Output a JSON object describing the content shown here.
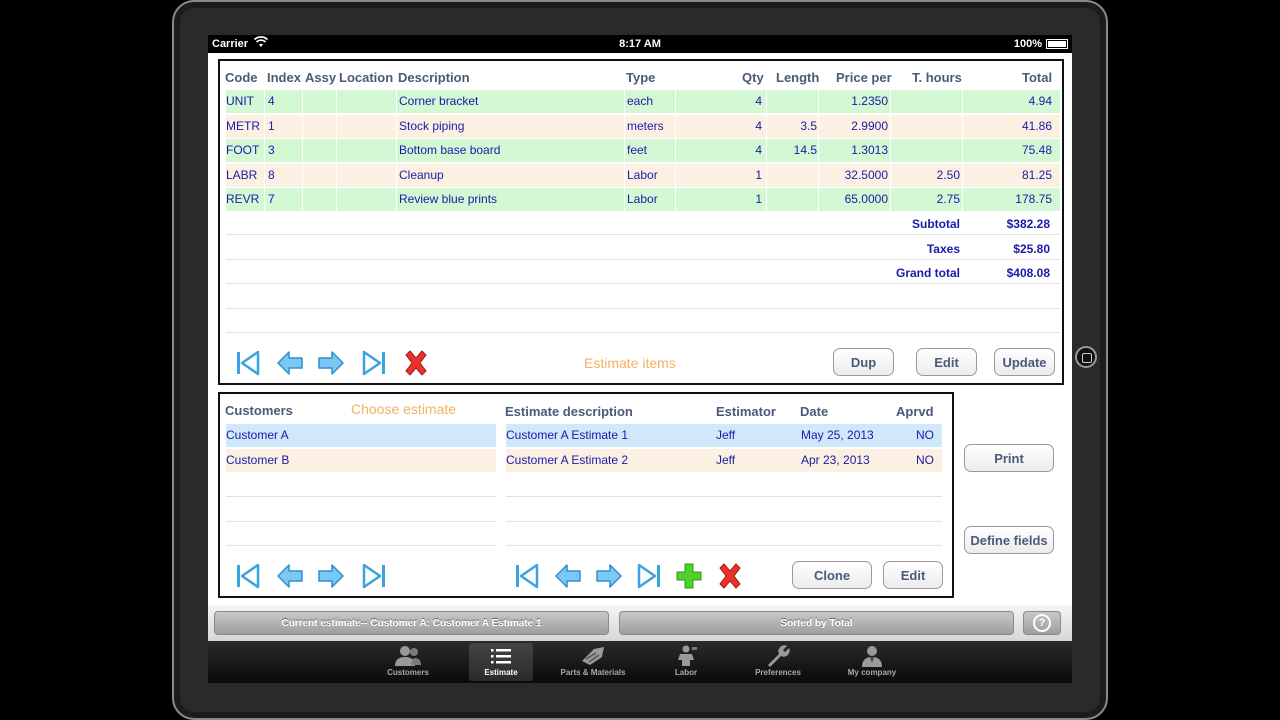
{
  "status_bar": {
    "carrier": "Carrier",
    "time": "8:17 AM",
    "battery": "100%"
  },
  "items_panel": {
    "columns": [
      "Code",
      "Index",
      "Assy",
      "Location",
      "Description",
      "Type",
      "Qty",
      "Length",
      "Price per",
      "T. hours",
      "Total"
    ],
    "rows": [
      {
        "code": "UNIT",
        "index": "4",
        "assy": "",
        "location": "",
        "description": "Corner bracket",
        "type": "each",
        "qty": "4",
        "length": "",
        "price": "1.2350",
        "hours": "",
        "total": "4.94"
      },
      {
        "code": "METR",
        "index": "1",
        "assy": "",
        "location": "",
        "description": "Stock piping",
        "type": "meters",
        "qty": "4",
        "length": "3.5",
        "price": "2.9900",
        "hours": "",
        "total": "41.86"
      },
      {
        "code": "FOOT",
        "index": "3",
        "assy": "",
        "location": "",
        "description": "Bottom base board",
        "type": "feet",
        "qty": "4",
        "length": "14.5",
        "price": "1.3013",
        "hours": "",
        "total": "75.48"
      },
      {
        "code": "LABR",
        "index": "8",
        "assy": "",
        "location": "",
        "description": "Cleanup",
        "type": "Labor",
        "qty": "1",
        "length": "",
        "price": "32.5000",
        "hours": "2.50",
        "total": "81.25"
      },
      {
        "code": "REVR",
        "index": "7",
        "assy": "",
        "location": "",
        "description": "Review blue prints",
        "type": "Labor",
        "qty": "1",
        "length": "",
        "price": "65.0000",
        "hours": "2.75",
        "total": "178.75"
      }
    ],
    "subtotal_label": "Subtotal",
    "subtotal": "$382.28",
    "taxes_label": "Taxes",
    "taxes": "$25.80",
    "grand_label": "Grand total",
    "grand": "$408.08",
    "caption": "Estimate items",
    "buttons": {
      "dup": "Dup",
      "edit": "Edit",
      "update": "Update"
    }
  },
  "estimate_panel": {
    "customers_header": "Customers",
    "choose_caption": "Choose estimate",
    "customers": [
      "Customer A",
      "Customer B"
    ],
    "columns": [
      "Estimate description",
      "Estimator",
      "Date",
      "Aprvd"
    ],
    "estimates": [
      {
        "description": "Customer A Estimate 1",
        "estimator": "Jeff",
        "date": "May 25, 2013",
        "approved": "NO"
      },
      {
        "description": "Customer A Estimate 2",
        "estimator": "Jeff",
        "date": "Apr 23, 2013",
        "approved": "NO"
      }
    ],
    "buttons": {
      "clone": "Clone",
      "edit": "Edit"
    }
  },
  "side_buttons": {
    "print": "Print",
    "define_fields": "Define fields"
  },
  "status_strip": {
    "current_estimate": "Current estimate--  Customer A: Customer A Estimate 1",
    "sorted_by": "Sorted by Total",
    "help": "?"
  },
  "tab_bar": {
    "tabs": [
      {
        "label": "Customers",
        "icon": "customers-icon",
        "active": false
      },
      {
        "label": "Estimate",
        "icon": "list-icon",
        "active": true
      },
      {
        "label": "Parts & Materials",
        "icon": "parts-icon",
        "active": false
      },
      {
        "label": "Labor",
        "icon": "worker-icon",
        "active": false
      },
      {
        "label": "Preferences",
        "icon": "wrench-icon",
        "active": false
      },
      {
        "label": "My company",
        "icon": "company-icon",
        "active": false
      }
    ]
  },
  "colors": {
    "row_green": "#d4f7d4",
    "row_peach": "#fbf0e2",
    "row_selected": "#cfe9fb",
    "text_blue": "#1a1aa8",
    "header_text": "#4a5a78",
    "caption_orange": "#f5b060"
  }
}
